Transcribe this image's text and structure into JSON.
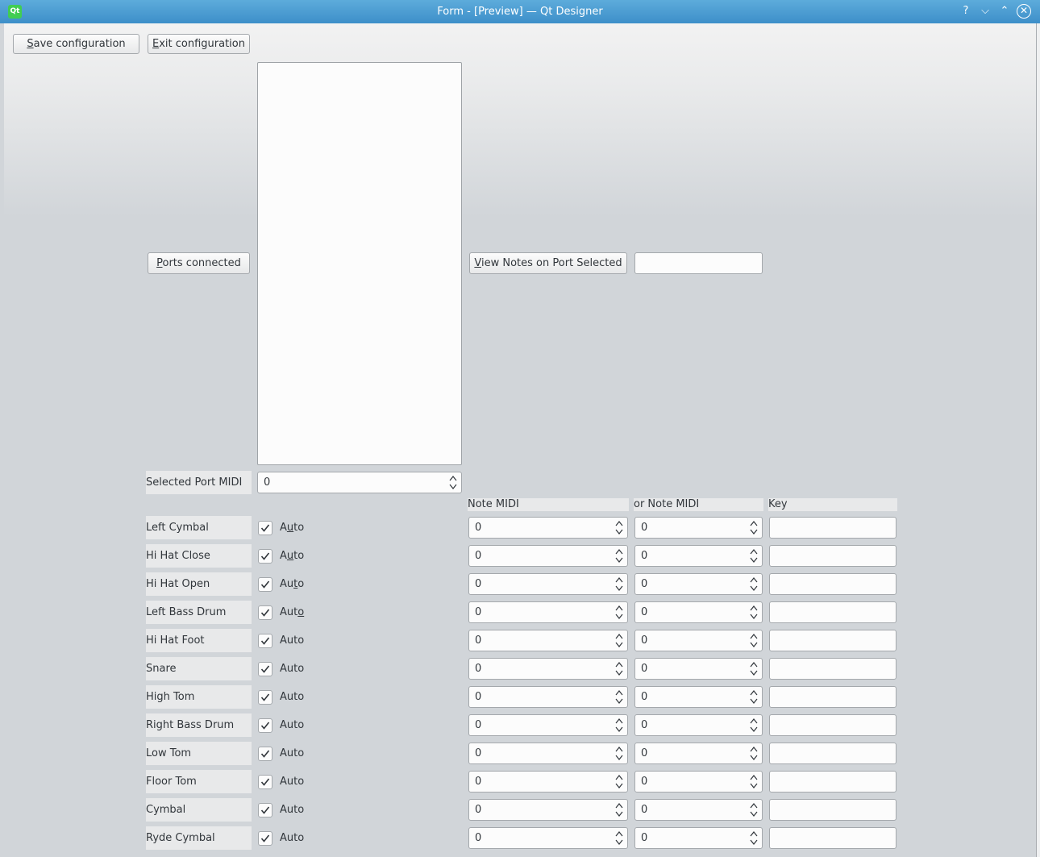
{
  "window": {
    "title": "Form - [Preview] — Qt Designer",
    "app_logo": "Qt",
    "controls": {
      "help": "?",
      "minimize": "⌵",
      "maximize": "⌃",
      "close": "✕"
    }
  },
  "toolbar": {
    "save_label_u": "S",
    "save_label_rest": "ave configuration",
    "exit_label_u": "E",
    "exit_label_rest": "xit configuration"
  },
  "ports": {
    "ports_button_u": "P",
    "ports_button_rest": "orts connected",
    "view_notes_u": "V",
    "view_notes_rest": "iew Notes on Port Selected",
    "notes_field_value": "",
    "selected_port_label": "Selected Port MIDI",
    "selected_port_value": "0"
  },
  "columns": {
    "note": "Note MIDI",
    "or_note": "or Note MIDI",
    "key": "Key"
  },
  "rows": [
    {
      "name": "Left Cymbal",
      "auto_pre": "A",
      "auto_u": "u",
      "auto_post": "to",
      "checked": true,
      "note": "0",
      "or_note": "0",
      "key": ""
    },
    {
      "name": "Hi Hat Close",
      "auto_pre": "A",
      "auto_u": "u",
      "auto_post": "to",
      "checked": true,
      "note": "0",
      "or_note": "0",
      "key": ""
    },
    {
      "name": "Hi Hat Open",
      "auto_pre": "Au",
      "auto_u": "t",
      "auto_post": "o",
      "checked": true,
      "note": "0",
      "or_note": "0",
      "key": ""
    },
    {
      "name": "Left Bass Drum",
      "auto_pre": "Aut",
      "auto_u": "o",
      "auto_post": "",
      "checked": true,
      "note": "0",
      "or_note": "0",
      "key": ""
    },
    {
      "name": "Hi Hat Foot",
      "auto_pre": "Auto",
      "auto_u": "",
      "auto_post": "",
      "checked": true,
      "note": "0",
      "or_note": "0",
      "key": ""
    },
    {
      "name": "Snare",
      "auto_pre": "Auto",
      "auto_u": "",
      "auto_post": "",
      "checked": true,
      "note": "0",
      "or_note": "0",
      "key": ""
    },
    {
      "name": "High Tom",
      "auto_pre": "Auto",
      "auto_u": "",
      "auto_post": "",
      "checked": true,
      "note": "0",
      "or_note": "0",
      "key": ""
    },
    {
      "name": "Right Bass Drum",
      "auto_pre": "Auto",
      "auto_u": "",
      "auto_post": "",
      "checked": true,
      "note": "0",
      "or_note": "0",
      "key": ""
    },
    {
      "name": "Low Tom",
      "auto_pre": "Auto",
      "auto_u": "",
      "auto_post": "",
      "checked": true,
      "note": "0",
      "or_note": "0",
      "key": ""
    },
    {
      "name": "Floor Tom",
      "auto_pre": "Auto",
      "auto_u": "",
      "auto_post": "",
      "checked": true,
      "note": "0",
      "or_note": "0",
      "key": ""
    },
    {
      "name": "Cymbal",
      "auto_pre": "Auto",
      "auto_u": "",
      "auto_post": "",
      "checked": true,
      "note": "0",
      "or_note": "0",
      "key": ""
    },
    {
      "name": "Ryde Cymbal",
      "auto_pre": "Auto",
      "auto_u": "",
      "auto_post": "",
      "checked": true,
      "note": "0",
      "or_note": "0",
      "key": ""
    }
  ],
  "colors": {
    "titlebar": "#3d8fc9",
    "window_bg": "#d1d5d9",
    "field_bg": "#fcfcfc"
  }
}
